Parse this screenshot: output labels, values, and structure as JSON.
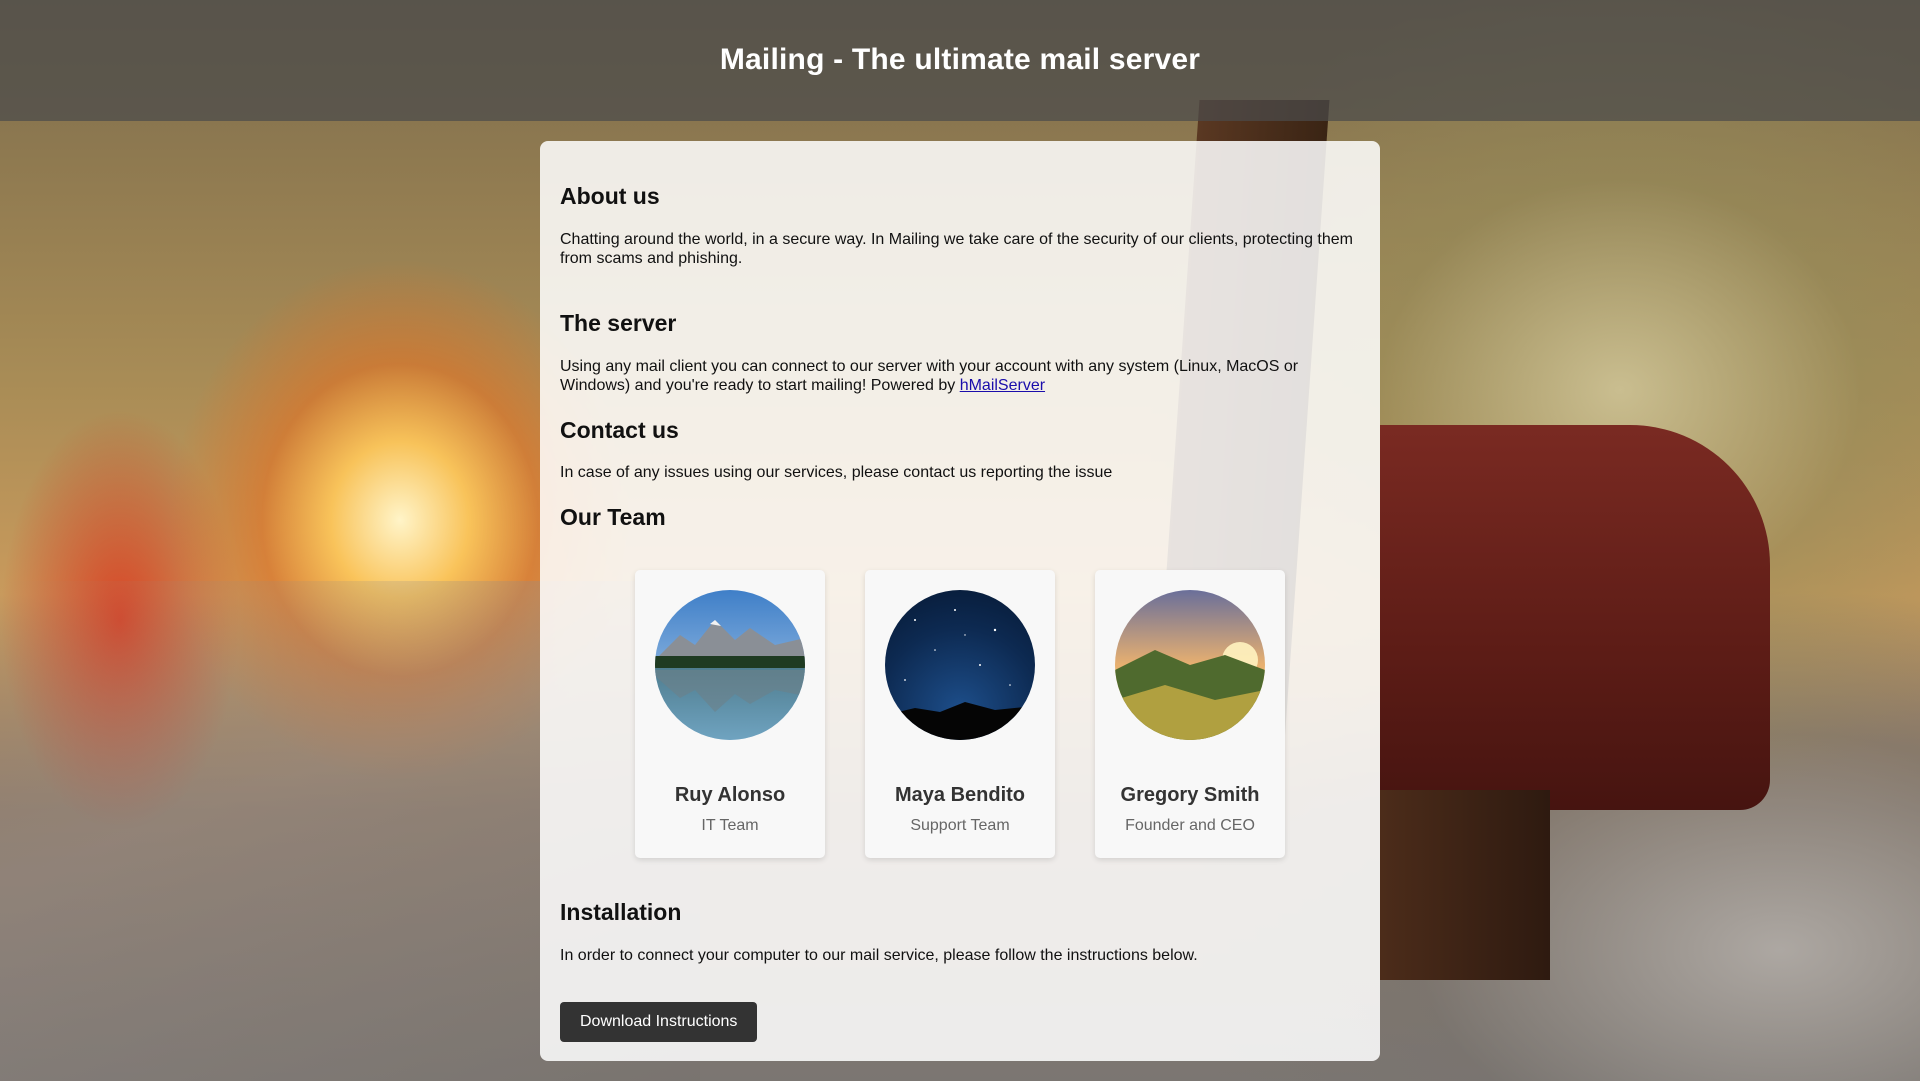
{
  "header": {
    "title": "Mailing - The ultimate mail server"
  },
  "about": {
    "heading": "About us",
    "text": "Chatting around the world, in a secure way. In Mailing we take care of the security of our clients, protecting them from scams and phishing."
  },
  "server": {
    "heading": "The server",
    "text_before_link": "Using any mail client you can connect to our server with your account with any system (Linux, MacOS or Windows) and you're ready to start mailing! Powered by ",
    "link_text": "hMailServer"
  },
  "contact": {
    "heading": "Contact us",
    "text": "In case of any issues using our services, please contact us reporting the issue"
  },
  "team": {
    "heading": "Our Team",
    "members": [
      {
        "name": "Ruy Alonso",
        "role": "IT Team",
        "avatar": "mountain-lake-photo"
      },
      {
        "name": "Maya Bendito",
        "role": "Support Team",
        "avatar": "night-sky-photo"
      },
      {
        "name": "Gregory Smith",
        "role": "Founder and CEO",
        "avatar": "sunset-hills-photo"
      }
    ]
  },
  "installation": {
    "heading": "Installation",
    "text": "In order to connect your computer to our mail service, please follow the instructions below.",
    "button_label": "Download Instructions"
  }
}
